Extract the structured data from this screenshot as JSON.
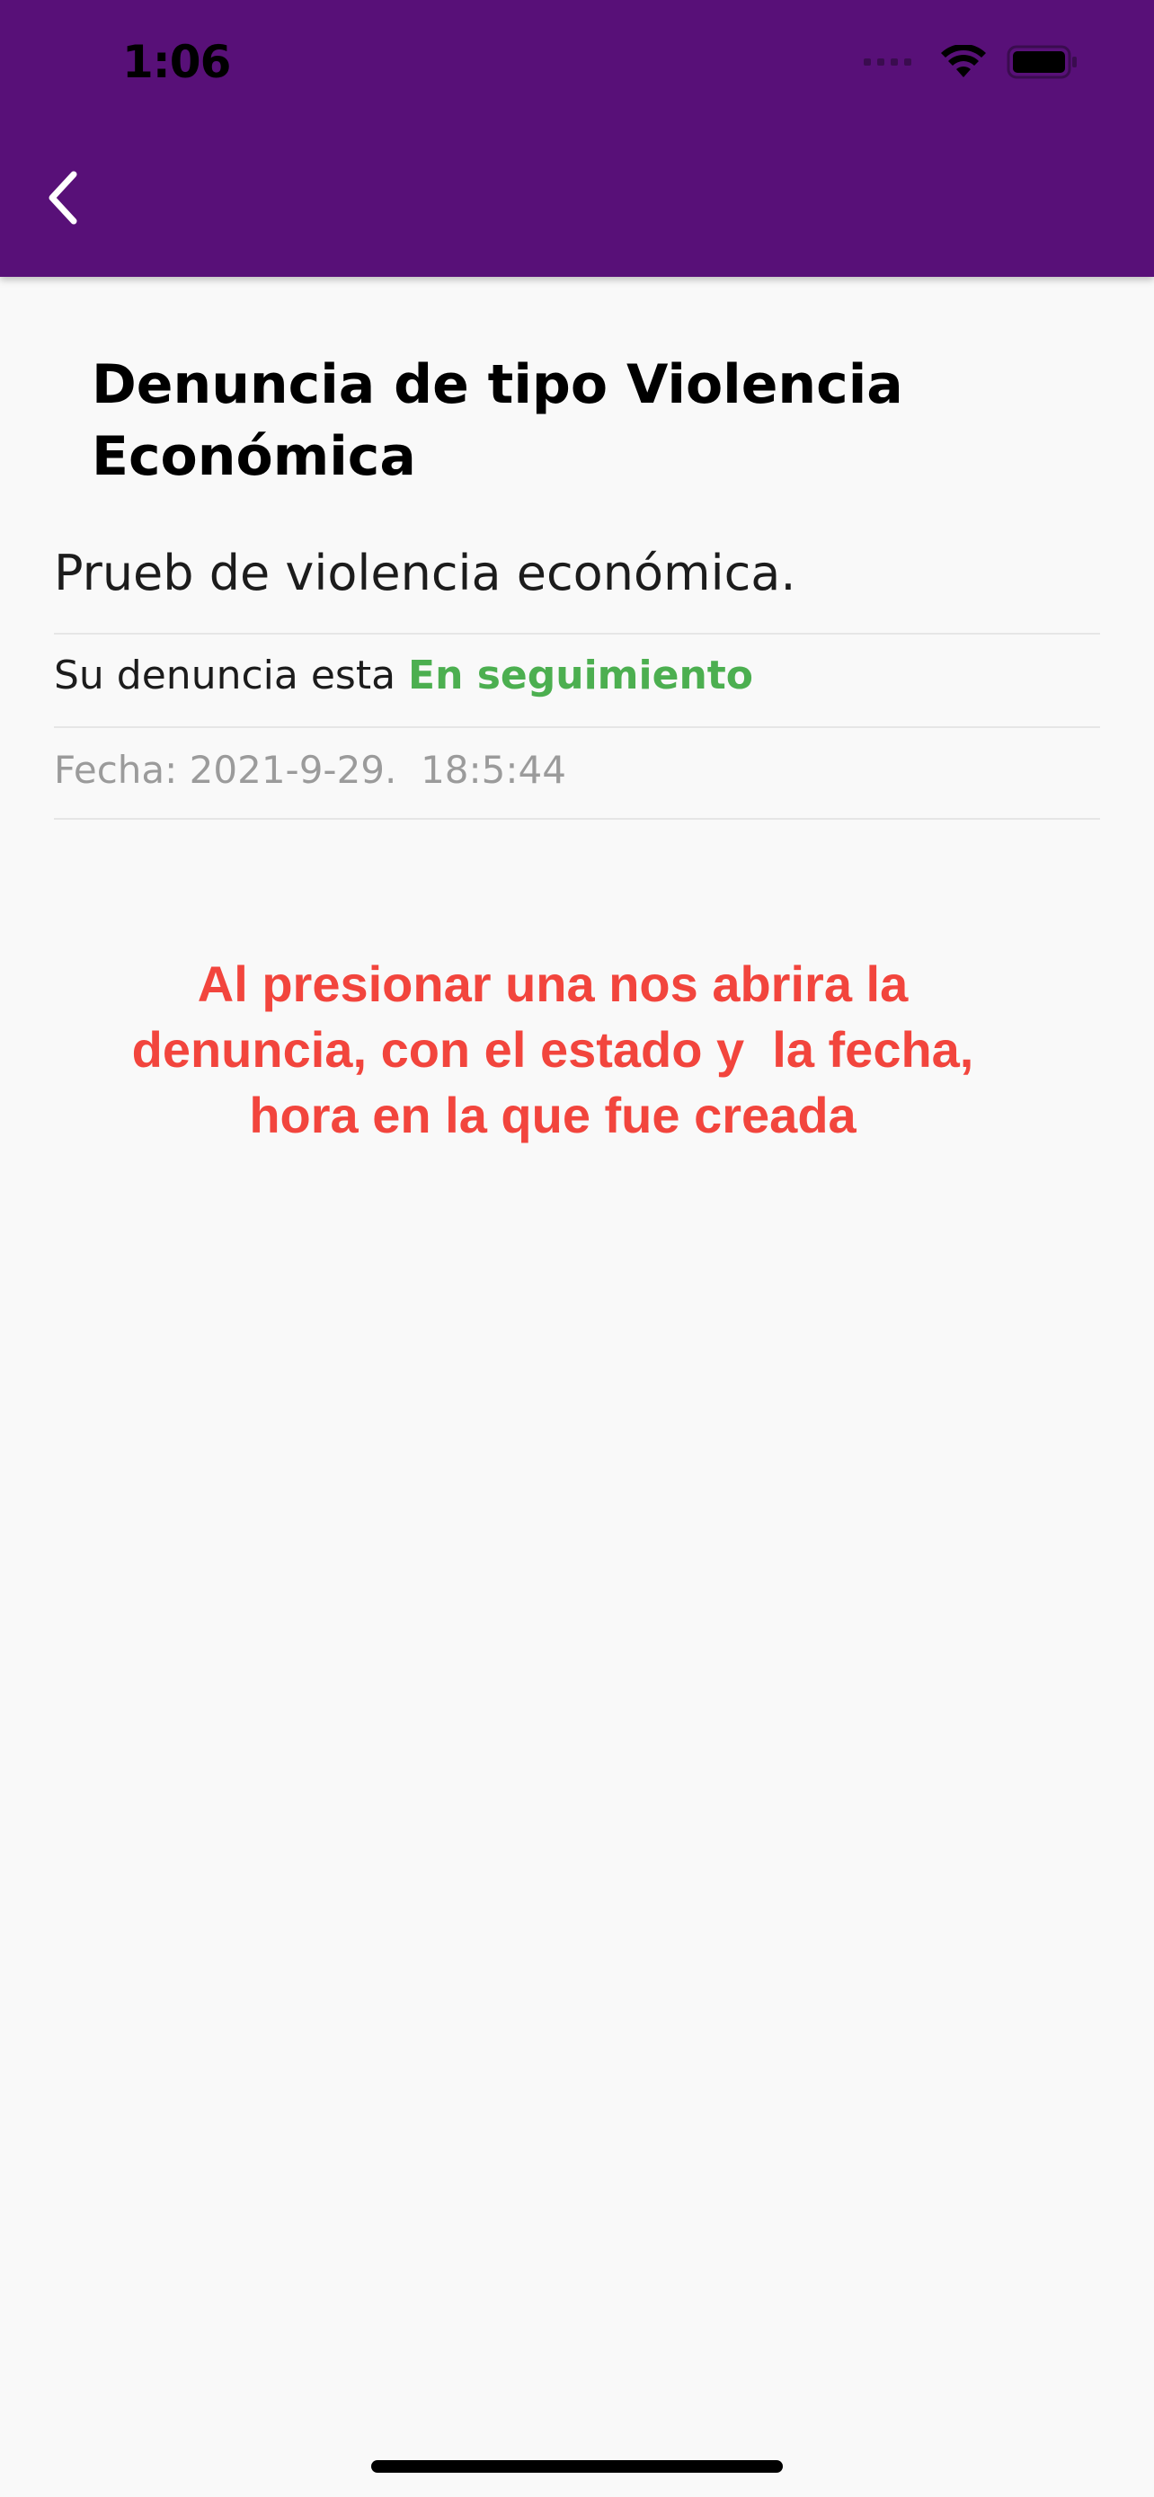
{
  "status_bar": {
    "time": "1:06"
  },
  "app_bar": {
    "background_color": "#581078",
    "back_icon": "chevron-left-icon"
  },
  "complaint": {
    "title": "Denuncia de tipo Violencia Económica",
    "description": "Prueb de violencia económica.",
    "status_prefix": "Su denuncia esta",
    "status_value": "En seguimiento",
    "status_color": "#4caf50",
    "date_text": "Fecha: 2021-9-29.  18:5:44"
  },
  "annotation": {
    "text": "Al presionar una nos abrira la\ndenuncia, con el estado y  la fecha,\nhora en la que fue creada",
    "color": "#f2453d"
  }
}
